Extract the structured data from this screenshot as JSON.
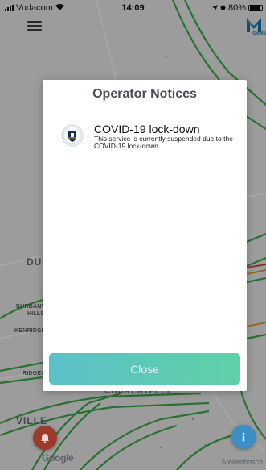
{
  "status_bar": {
    "carrier": "Vodacom",
    "time": "14:09",
    "battery": "80%",
    "icons": [
      "signal-icon",
      "wifi-icon",
      "location-arrow-icon",
      "alarm-icon",
      "battery-icon"
    ]
  },
  "header": {
    "menu_icon": "hamburger-menu-icon",
    "logo_text": "GoMe"
  },
  "map": {
    "labels": [
      "DUR",
      "DURBANV",
      "HILLS",
      "KENRIDGE",
      "RIDGEW",
      "VILLE",
      "CHURENTFLEE",
      "Stellenbosch"
    ],
    "attribution": "Google"
  },
  "modal": {
    "title": "Operator Notices",
    "notices": [
      {
        "title": "COVID-19 lock-down",
        "body": "This service is currently suspended due to the COVID-19 lock-down",
        "icon": "university-crest-icon"
      }
    ],
    "close_label": "Close"
  },
  "colors": {
    "close_gradient_start": "#5cc0c8",
    "close_gradient_end": "#5fd1a7",
    "traffic_green": "#3cae4c",
    "overlay": "rgba(0,0,0,0.35)",
    "fab_red": "#9c3a2c",
    "fab_blue": "#3b8fc4"
  },
  "fab": {
    "left_icon": "alert-bell-icon",
    "right_icon": "info-icon"
  }
}
